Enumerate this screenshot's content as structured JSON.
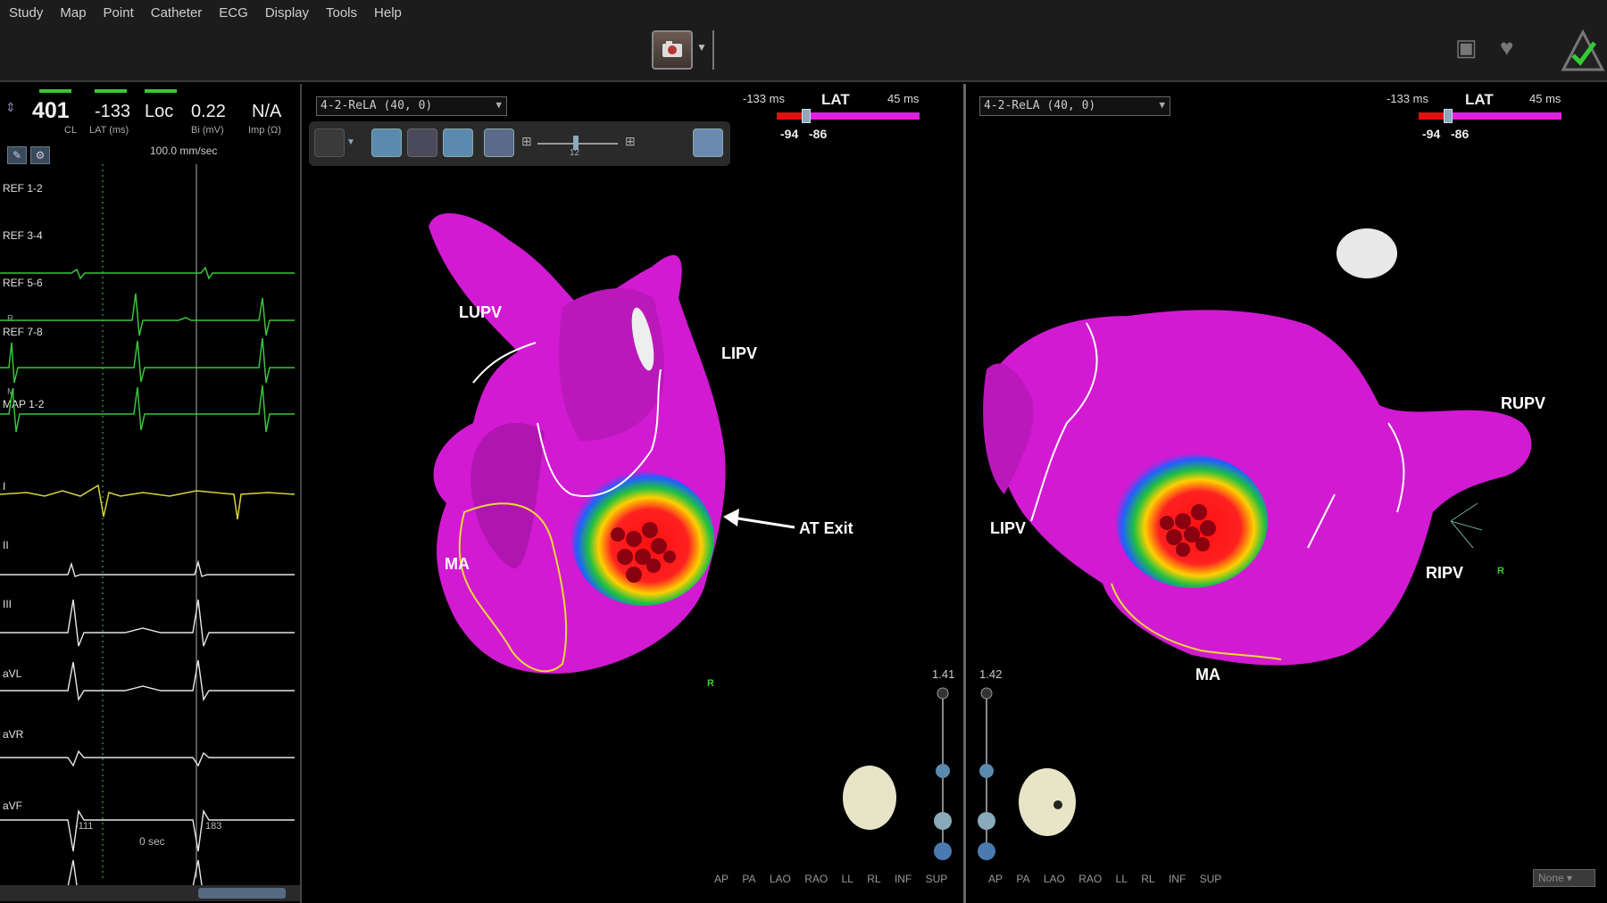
{
  "menu": [
    "Study",
    "Map",
    "Point",
    "Catheter",
    "ECG",
    "Display",
    "Tools",
    "Help"
  ],
  "icons": {
    "camera": "camera-icon",
    "screen": "screen-icon",
    "heart": "heart-icon",
    "logo": "carto-logo-icon"
  },
  "colors": {
    "map_surface": "#d21ad2",
    "ecg_green": "#39c43a",
    "ecg_yellow": "#d8d33a",
    "ecg_white": "#e6e6e6",
    "lat_red": "#e01010",
    "lat_magenta": "#e020e0"
  },
  "header": {
    "cl_value": "401",
    "cl_label": "CL",
    "lat_value": "-133",
    "lat_label": "LAT (ms)",
    "loc_value": "Loc",
    "bi_value": "0.22",
    "bi_label": "Bi (mV)",
    "imp_value": "N/A",
    "imp_label": "Imp (Ω)"
  },
  "sweep_speed": "100.0 mm/sec",
  "leads": [
    "REF 1-2",
    "REF 3-4",
    "REF 5-6",
    "REF 7-8",
    "MAP 1-2",
    "I",
    "II",
    "III",
    "aVL",
    "aVR",
    "aVF"
  ],
  "lead_small": [
    "R",
    "M"
  ],
  "time_labels": {
    "left": "-111",
    "right": "183",
    "zero": "0 sec"
  },
  "map_left": {
    "dropdown": "4-2-ReLA (40, 0)",
    "lat_min": "-133 ms",
    "lat_title": "LAT",
    "lat_max": "45 ms",
    "range_low": "-94",
    "range_high": "-86",
    "slider_value": "12",
    "zoom": "1.41",
    "labels": {
      "lupv": "LUPV",
      "lipv": "LIPV",
      "ma": "MA",
      "at_exit": "AT Exit",
      "r": "R"
    },
    "views": [
      "AP",
      "PA",
      "LAO",
      "RAO",
      "LL",
      "RL",
      "INF",
      "SUP"
    ]
  },
  "map_right": {
    "dropdown": "4-2-ReLA (40, 0)",
    "lat_min": "-133 ms",
    "lat_title": "LAT",
    "lat_max": "45 ms",
    "range_low": "-94",
    "range_high": "-86",
    "zoom": "1.42",
    "labels": {
      "rupv": "RUPV",
      "lipv": "LIPV",
      "ripv": "RIPV",
      "ma": "MA",
      "r": "R"
    },
    "views": [
      "AP",
      "PA",
      "LAO",
      "RAO",
      "LL",
      "RL",
      "INF",
      "SUP"
    ],
    "none_select": "None"
  }
}
